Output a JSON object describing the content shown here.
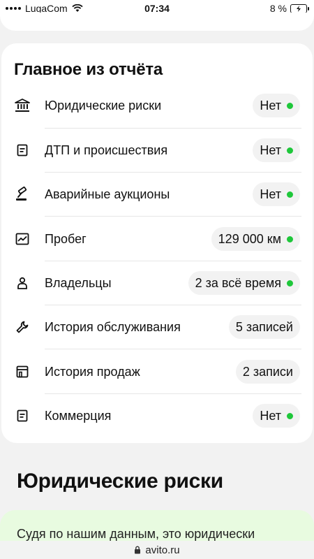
{
  "status_bar": {
    "carrier": "LugaCom",
    "time": "07:34",
    "battery": "8 %"
  },
  "summary": {
    "title": "Главное из отчёта",
    "rows": [
      {
        "label": "Юридические риски",
        "value": "Нет",
        "status": "green",
        "icon": "bank-icon"
      },
      {
        "label": "ДТП и происшествия",
        "value": "Нет",
        "status": "green",
        "icon": "document-icon"
      },
      {
        "label": "Аварийные аукционы",
        "value": "Нет",
        "status": "green",
        "icon": "gavel-icon"
      },
      {
        "label": "Пробег",
        "value": "129 000 км",
        "status": "green",
        "icon": "chart-icon"
      },
      {
        "label": "Владельцы",
        "value": "2 за всё время",
        "status": "green",
        "icon": "person-icon"
      },
      {
        "label": "История обслуживания",
        "value": "5 записей",
        "status": "none",
        "icon": "wrench-icon"
      },
      {
        "label": "История продаж",
        "value": "2 записи",
        "status": "none",
        "icon": "store-icon"
      },
      {
        "label": "Коммерция",
        "value": "Нет",
        "status": "green",
        "icon": "document-icon"
      }
    ]
  },
  "legal_section": {
    "title": "Юридические риски",
    "text": "Судя по нашим данным, это юридически"
  },
  "browser": {
    "url": "avito.ru"
  },
  "colors": {
    "status_green": "#1ec73a",
    "badge_bg": "#f2f2f2",
    "card_bg": "#ffffff",
    "page_bg": "#f2f2f2",
    "info_bg": "#e8fbe0"
  }
}
